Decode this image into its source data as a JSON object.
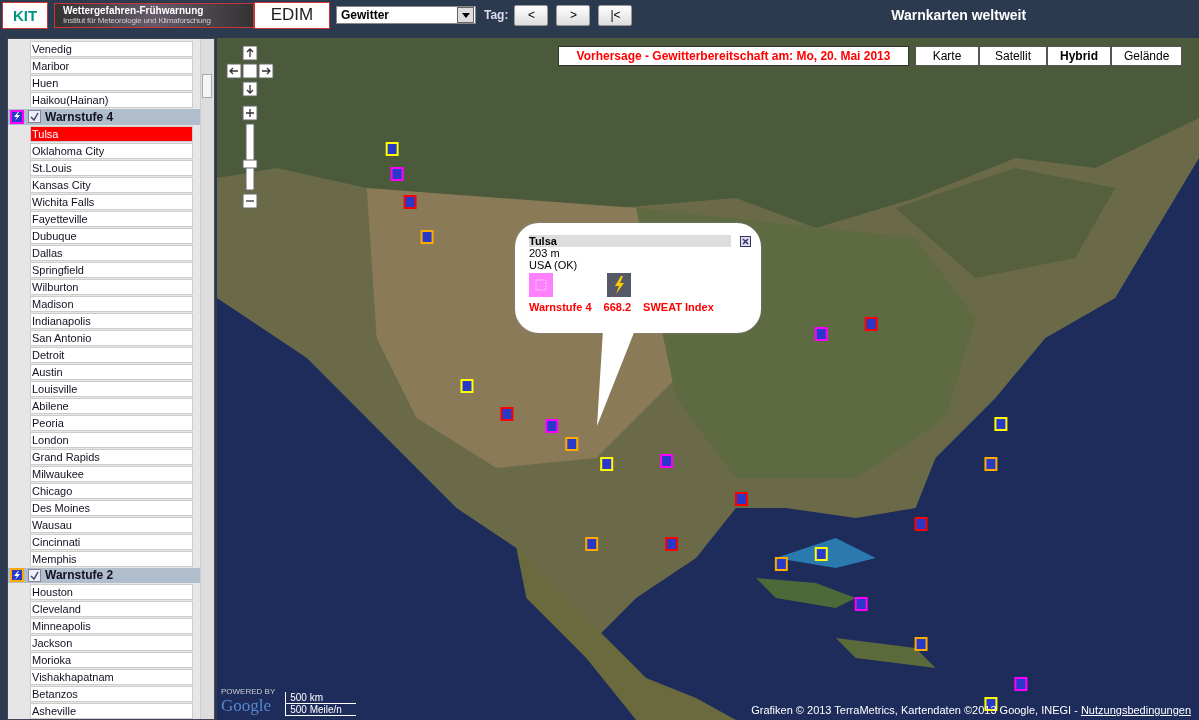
{
  "header": {
    "logo_left": "KIT",
    "banner_title": "Wettergefahren-Frühwarnung",
    "banner_subtitle": "Institut für Meteorologie und Klimaforschung",
    "logo_right": "EDIM",
    "hazard_select": {
      "value": "Gewitter"
    },
    "day_label": "Tag:",
    "day_buttons": [
      "<",
      ">",
      "|<"
    ],
    "title": "Warnkarten weltweit"
  },
  "sidebar": {
    "groups": [
      {
        "items": [
          {
            "label": "Venedig",
            "selected": false
          },
          {
            "label": "Maribor",
            "selected": false
          },
          {
            "label": "Huen",
            "selected": false
          },
          {
            "label": "Haikou(Hainan)",
            "selected": false
          }
        ]
      },
      {
        "title": "Warnstufe 4",
        "checked": true,
        "color": "#ff00ff",
        "items": [
          {
            "label": "Tulsa",
            "selected": true
          },
          {
            "label": "Oklahoma City",
            "selected": false
          },
          {
            "label": "St.Louis",
            "selected": false
          },
          {
            "label": "Kansas City",
            "selected": false
          },
          {
            "label": "Wichita Falls",
            "selected": false
          },
          {
            "label": "Fayetteville",
            "selected": false
          },
          {
            "label": "Dubuque",
            "selected": false
          },
          {
            "label": "Dallas",
            "selected": false
          },
          {
            "label": "Springfield",
            "selected": false
          },
          {
            "label": "Wilburton",
            "selected": false
          },
          {
            "label": "Madison",
            "selected": false
          },
          {
            "label": "Indianapolis",
            "selected": false
          },
          {
            "label": "San Antonio",
            "selected": false
          },
          {
            "label": "Detroit",
            "selected": false
          },
          {
            "label": "Austin",
            "selected": false
          },
          {
            "label": "Louisville",
            "selected": false
          },
          {
            "label": "Abilene",
            "selected": false
          },
          {
            "label": "Peoria",
            "selected": false
          },
          {
            "label": "London",
            "selected": false
          },
          {
            "label": "Grand Rapids",
            "selected": false
          },
          {
            "label": "Milwaukee",
            "selected": false
          },
          {
            "label": "Chicago",
            "selected": false
          },
          {
            "label": "Des Moines",
            "selected": false
          },
          {
            "label": "Wausau",
            "selected": false
          },
          {
            "label": "Cincinnati",
            "selected": false
          },
          {
            "label": "Memphis",
            "selected": false
          }
        ]
      },
      {
        "title": "Warnstufe 2",
        "checked": true,
        "color": "#ffaa00",
        "items": [
          {
            "label": "Houston",
            "selected": false
          },
          {
            "label": "Cleveland",
            "selected": false
          },
          {
            "label": "Minneapolis",
            "selected": false
          },
          {
            "label": "Jackson",
            "selected": false
          },
          {
            "label": "Morioka",
            "selected": false
          },
          {
            "label": "Vishakhapatnam",
            "selected": false
          },
          {
            "label": "Betanzos",
            "selected": false
          },
          {
            "label": "Asheville",
            "selected": false
          }
        ]
      }
    ]
  },
  "map": {
    "forecast_banner": "Vorhersage - Gewitterbereitschaft am: Mo, 20. Mai 2013",
    "map_types": [
      {
        "label": "Karte",
        "selected": false
      },
      {
        "label": "Satellit",
        "selected": false
      },
      {
        "label": "Hybrid",
        "selected": true
      },
      {
        "label": "Gelände",
        "selected": false
      }
    ],
    "popup": {
      "title": "Tulsa",
      "elevation": "203 m",
      "region": "USA (OK)",
      "level_label": "Warnstufe 4",
      "value": "668.2",
      "index_label": "SWEAT Index"
    },
    "powered_by": "POWERED BY",
    "google_logo": "Google",
    "scale": [
      "500 km",
      "500 Meile/n"
    ],
    "attribution": "Grafiken © 2013 TerraMetrics, Kartendaten ©2013 Google, INEGI -",
    "terms_link": "Nutzungsbedingungen"
  }
}
